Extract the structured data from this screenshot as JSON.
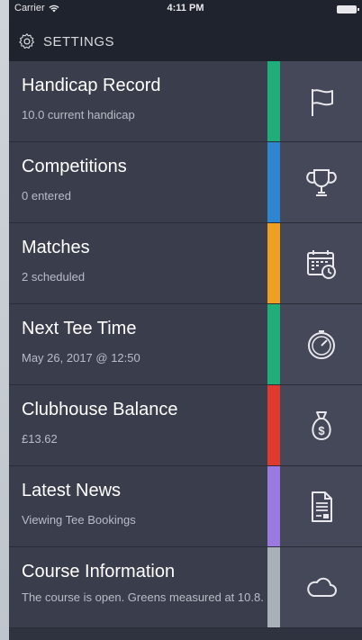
{
  "statusbar": {
    "carrier": "Carrier",
    "time": "4:11 PM"
  },
  "navbar": {
    "title": "SETTINGS",
    "icon": "gear-icon"
  },
  "rows": [
    {
      "label": "Handicap Record",
      "sub": "10.0 current handicap",
      "color": "#1fae7a",
      "icon": "flag-icon"
    },
    {
      "label": "Competitions",
      "sub": "0 entered",
      "color": "#2e86d1",
      "icon": "trophy-icon"
    },
    {
      "label": "Matches",
      "sub": "2 scheduled",
      "color": "#f0a020",
      "icon": "calendar-clock-icon"
    },
    {
      "label": "Next Tee Time",
      "sub": "May 26, 2017 @ 12:50",
      "color": "#1fae7a",
      "icon": "stopwatch-icon"
    },
    {
      "label": "Clubhouse Balance",
      "sub": "£13.62",
      "color": "#e0392f",
      "icon": "money-bag-icon"
    },
    {
      "label": "Latest News",
      "sub": "Viewing Tee Bookings",
      "color": "#9a7ae0",
      "icon": "document-icon"
    },
    {
      "label": "Course Information",
      "sub": "The course is open. Greens measured at 10.8.",
      "color": "#a9b1b8",
      "icon": "cloud-icon"
    }
  ]
}
